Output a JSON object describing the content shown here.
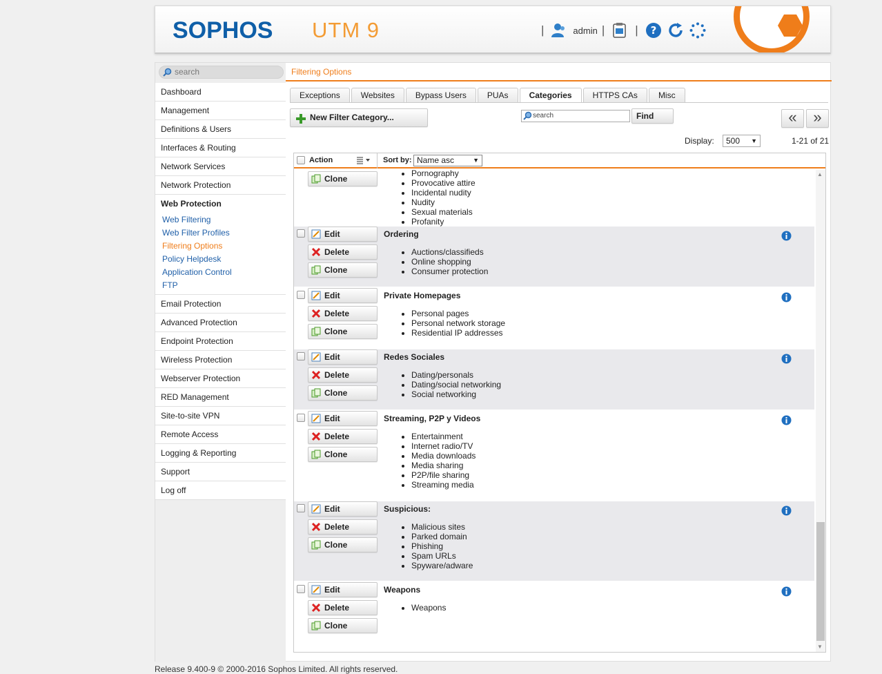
{
  "header": {
    "logo": "SOPHOS",
    "product": "UTM 9",
    "user": "admin"
  },
  "sidebar": {
    "search_placeholder": "search",
    "items": [
      "Dashboard",
      "Management",
      "Definitions & Users",
      "Interfaces & Routing",
      "Network Services",
      "Network Protection"
    ],
    "active_group": "Web Protection",
    "sub_items": [
      "Web Filtering",
      "Web Filter Profiles",
      "Filtering Options",
      "Policy Helpdesk",
      "Application Control",
      "FTP"
    ],
    "items_after": [
      "Email Protection",
      "Advanced Protection",
      "Endpoint Protection",
      "Wireless Protection",
      "Webserver Protection",
      "RED Management",
      "Site-to-site VPN",
      "Remote Access",
      "Logging & Reporting",
      "Support",
      "Log off"
    ]
  },
  "breadcrumb": "Filtering Options",
  "tabs": [
    "Exceptions",
    "Websites",
    "Bypass Users",
    "PUAs",
    "Categories",
    "HTTPS CAs",
    "Misc"
  ],
  "toolbar": {
    "new_label": "New Filter Category...",
    "search_placeholder": "search",
    "find_label": "Find",
    "prev_label": "«",
    "next_label": "»",
    "display_label": "Display:",
    "display_value": "500",
    "range": "1-21 of 21"
  },
  "list": {
    "action_label": "Action",
    "sort_label": "Sort by:",
    "sort_value": "Name asc",
    "edit_label": "Edit",
    "delete_label": "Delete",
    "clone_label": "Clone",
    "rows": [
      {
        "title": "",
        "items": [
          "Pornography",
          "Provocative attire",
          "Incidental nudity",
          "Nudity",
          "Sexual materials",
          "Profanity"
        ]
      },
      {
        "title": "Ordering",
        "items": [
          "Auctions/classifieds",
          "Online shopping",
          "Consumer protection"
        ]
      },
      {
        "title": "Private Homepages",
        "items": [
          "Personal pages",
          "Personal network storage",
          "Residential IP addresses"
        ]
      },
      {
        "title": "Redes Sociales",
        "items": [
          "Dating/personals",
          "Dating/social networking",
          "Social networking"
        ]
      },
      {
        "title": "Streaming, P2P y Videos",
        "items": [
          "Entertainment",
          "Internet radio/TV",
          "Media downloads",
          "Media sharing",
          "P2P/file sharing",
          "Streaming media"
        ]
      },
      {
        "title": "Suspicious:",
        "items": [
          "Malicious sites",
          "Parked domain",
          "Phishing",
          "Spam URLs",
          "Spyware/adware"
        ]
      },
      {
        "title": "Weapons",
        "items": [
          "Weapons"
        ]
      }
    ]
  },
  "footer": "Release 9.400-9  © 2000-2016 Sophos Limited. All rights reserved.",
  "colors": {
    "brand_blue": "#0f5fa8",
    "accent_orange": "#ef7d1a",
    "link_blue": "#1f5fa8"
  }
}
